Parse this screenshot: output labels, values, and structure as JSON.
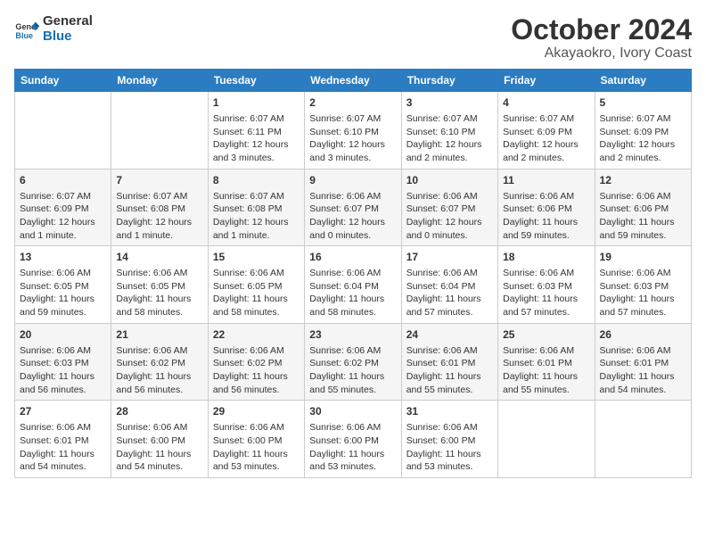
{
  "logo": {
    "text_general": "General",
    "text_blue": "Blue"
  },
  "title": "October 2024",
  "subtitle": "Akayaokro, Ivory Coast",
  "days_of_week": [
    "Sunday",
    "Monday",
    "Tuesday",
    "Wednesday",
    "Thursday",
    "Friday",
    "Saturday"
  ],
  "weeks": [
    [
      {
        "day": "",
        "detail": ""
      },
      {
        "day": "",
        "detail": ""
      },
      {
        "day": "1",
        "detail": "Sunrise: 6:07 AM\nSunset: 6:11 PM\nDaylight: 12 hours and 3 minutes."
      },
      {
        "day": "2",
        "detail": "Sunrise: 6:07 AM\nSunset: 6:10 PM\nDaylight: 12 hours and 3 minutes."
      },
      {
        "day": "3",
        "detail": "Sunrise: 6:07 AM\nSunset: 6:10 PM\nDaylight: 12 hours and 2 minutes."
      },
      {
        "day": "4",
        "detail": "Sunrise: 6:07 AM\nSunset: 6:09 PM\nDaylight: 12 hours and 2 minutes."
      },
      {
        "day": "5",
        "detail": "Sunrise: 6:07 AM\nSunset: 6:09 PM\nDaylight: 12 hours and 2 minutes."
      }
    ],
    [
      {
        "day": "6",
        "detail": "Sunrise: 6:07 AM\nSunset: 6:09 PM\nDaylight: 12 hours and 1 minute."
      },
      {
        "day": "7",
        "detail": "Sunrise: 6:07 AM\nSunset: 6:08 PM\nDaylight: 12 hours and 1 minute."
      },
      {
        "day": "8",
        "detail": "Sunrise: 6:07 AM\nSunset: 6:08 PM\nDaylight: 12 hours and 1 minute."
      },
      {
        "day": "9",
        "detail": "Sunrise: 6:06 AM\nSunset: 6:07 PM\nDaylight: 12 hours and 0 minutes."
      },
      {
        "day": "10",
        "detail": "Sunrise: 6:06 AM\nSunset: 6:07 PM\nDaylight: 12 hours and 0 minutes."
      },
      {
        "day": "11",
        "detail": "Sunrise: 6:06 AM\nSunset: 6:06 PM\nDaylight: 11 hours and 59 minutes."
      },
      {
        "day": "12",
        "detail": "Sunrise: 6:06 AM\nSunset: 6:06 PM\nDaylight: 11 hours and 59 minutes."
      }
    ],
    [
      {
        "day": "13",
        "detail": "Sunrise: 6:06 AM\nSunset: 6:05 PM\nDaylight: 11 hours and 59 minutes."
      },
      {
        "day": "14",
        "detail": "Sunrise: 6:06 AM\nSunset: 6:05 PM\nDaylight: 11 hours and 58 minutes."
      },
      {
        "day": "15",
        "detail": "Sunrise: 6:06 AM\nSunset: 6:05 PM\nDaylight: 11 hours and 58 minutes."
      },
      {
        "day": "16",
        "detail": "Sunrise: 6:06 AM\nSunset: 6:04 PM\nDaylight: 11 hours and 58 minutes."
      },
      {
        "day": "17",
        "detail": "Sunrise: 6:06 AM\nSunset: 6:04 PM\nDaylight: 11 hours and 57 minutes."
      },
      {
        "day": "18",
        "detail": "Sunrise: 6:06 AM\nSunset: 6:03 PM\nDaylight: 11 hours and 57 minutes."
      },
      {
        "day": "19",
        "detail": "Sunrise: 6:06 AM\nSunset: 6:03 PM\nDaylight: 11 hours and 57 minutes."
      }
    ],
    [
      {
        "day": "20",
        "detail": "Sunrise: 6:06 AM\nSunset: 6:03 PM\nDaylight: 11 hours and 56 minutes."
      },
      {
        "day": "21",
        "detail": "Sunrise: 6:06 AM\nSunset: 6:02 PM\nDaylight: 11 hours and 56 minutes."
      },
      {
        "day": "22",
        "detail": "Sunrise: 6:06 AM\nSunset: 6:02 PM\nDaylight: 11 hours and 56 minutes."
      },
      {
        "day": "23",
        "detail": "Sunrise: 6:06 AM\nSunset: 6:02 PM\nDaylight: 11 hours and 55 minutes."
      },
      {
        "day": "24",
        "detail": "Sunrise: 6:06 AM\nSunset: 6:01 PM\nDaylight: 11 hours and 55 minutes."
      },
      {
        "day": "25",
        "detail": "Sunrise: 6:06 AM\nSunset: 6:01 PM\nDaylight: 11 hours and 55 minutes."
      },
      {
        "day": "26",
        "detail": "Sunrise: 6:06 AM\nSunset: 6:01 PM\nDaylight: 11 hours and 54 minutes."
      }
    ],
    [
      {
        "day": "27",
        "detail": "Sunrise: 6:06 AM\nSunset: 6:01 PM\nDaylight: 11 hours and 54 minutes."
      },
      {
        "day": "28",
        "detail": "Sunrise: 6:06 AM\nSunset: 6:00 PM\nDaylight: 11 hours and 54 minutes."
      },
      {
        "day": "29",
        "detail": "Sunrise: 6:06 AM\nSunset: 6:00 PM\nDaylight: 11 hours and 53 minutes."
      },
      {
        "day": "30",
        "detail": "Sunrise: 6:06 AM\nSunset: 6:00 PM\nDaylight: 11 hours and 53 minutes."
      },
      {
        "day": "31",
        "detail": "Sunrise: 6:06 AM\nSunset: 6:00 PM\nDaylight: 11 hours and 53 minutes."
      },
      {
        "day": "",
        "detail": ""
      },
      {
        "day": "",
        "detail": ""
      }
    ]
  ]
}
